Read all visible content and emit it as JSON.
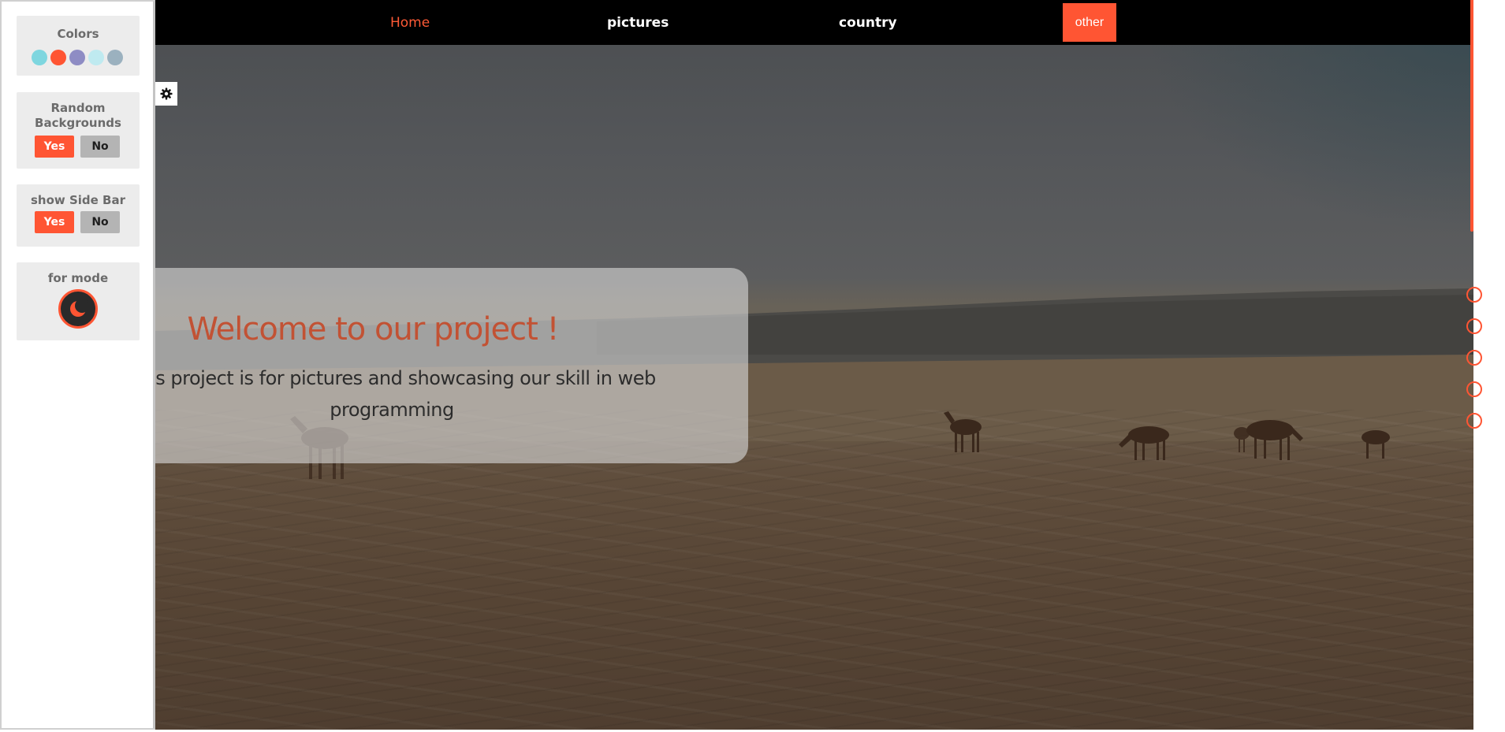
{
  "navbar": {
    "links": [
      {
        "label": "Home",
        "active": true
      },
      {
        "label": "pictures",
        "active": false
      },
      {
        "label": "country",
        "active": false
      }
    ],
    "other_label": "other"
  },
  "settings": {
    "colors": {
      "title": "Colors",
      "swatches": [
        "#7ed6df",
        "#ff5533",
        "#8e8cc4",
        "#bfeaf0",
        "#9bb1bf"
      ]
    },
    "random_backgrounds": {
      "title": "Random Backgrounds",
      "yes": "Yes",
      "no": "No"
    },
    "side_bar": {
      "title": "show Side Bar",
      "yes": "Yes",
      "no": "No"
    },
    "mode": {
      "title": "for mode",
      "icon": "moon-icon"
    }
  },
  "welcome": {
    "title": "Welcome to our project !",
    "text": "This project is for pictures and showcasing our skill in web programming"
  },
  "bullets": {
    "count": 5
  },
  "theme": {
    "accent": "#ff5533",
    "navbar_bg": "#000000"
  }
}
